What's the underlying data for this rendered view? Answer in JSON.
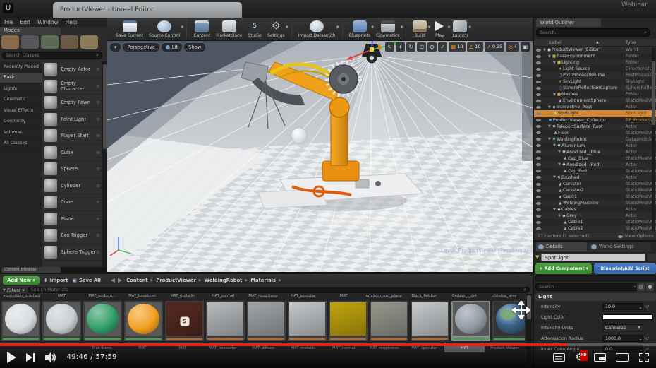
{
  "window": {
    "logo": "U",
    "tab_title": "ProductViewer - Unreal Editor",
    "menu": [
      "File",
      "Edit",
      "Window",
      "Help"
    ],
    "watermark": "Webinar"
  },
  "toolbar": {
    "buttons": [
      {
        "label": "Save Current",
        "icon": "save"
      },
      {
        "label": "Source Control",
        "icon": "sourcecontrol",
        "dropdown": true,
        "sep": true
      },
      {
        "label": "Content",
        "icon": "content"
      },
      {
        "label": "Marketplace",
        "icon": "marketplace"
      },
      {
        "label": "Studio",
        "icon": "studio",
        "glyph": "S"
      },
      {
        "label": "Settings",
        "icon": "settings",
        "glyph": "⚙",
        "dropdown": true,
        "sep": true
      },
      {
        "label": "Import Datasmith",
        "icon": "import",
        "dropdown": true,
        "sep": true
      },
      {
        "label": "Blueprints",
        "icon": "blueprints",
        "dropdown": true
      },
      {
        "label": "Cinematics",
        "icon": "cinematics",
        "dropdown": true,
        "sep": true
      },
      {
        "label": "Build",
        "icon": "build",
        "dropdown": true
      },
      {
        "label": "Play",
        "icon": "play",
        "dropdown": true
      },
      {
        "label": "Launch",
        "icon": "launch",
        "dropdown": true
      }
    ]
  },
  "modes": {
    "title": "Modes",
    "search_placeholder": "Search Classes",
    "categories": [
      {
        "label": "Recently Placed"
      },
      {
        "label": "Basic",
        "active": true
      },
      {
        "label": "Lights"
      },
      {
        "label": "Cinematic"
      },
      {
        "label": "Visual Effects"
      },
      {
        "label": "Geometry"
      },
      {
        "label": "Volumes"
      },
      {
        "label": "All Classes"
      }
    ],
    "items": [
      {
        "label": "Empty Actor"
      },
      {
        "label": "Empty Character"
      },
      {
        "label": "Empty Pawn"
      },
      {
        "label": "Point Light"
      },
      {
        "label": "Player Start"
      },
      {
        "label": "Cube"
      },
      {
        "label": "Sphere"
      },
      {
        "label": "Cylinder"
      },
      {
        "label": "Cone"
      },
      {
        "label": "Plane"
      },
      {
        "label": "Box Trigger"
      },
      {
        "label": "Sphere Trigger"
      }
    ]
  },
  "viewport": {
    "camera": "Perspective",
    "view_mode": "Lit",
    "show_menu": "Show",
    "snaps": [
      {
        "icon": "▦",
        "value": "10"
      },
      {
        "icon": "∠",
        "value": "10"
      },
      {
        "icon": "↗",
        "value": "0.25"
      },
      {
        "icon": "◎",
        "value": "4"
      }
    ],
    "level_label": "Level: ProductViewer (Persistent)"
  },
  "outliner": {
    "tab": "World Outliner",
    "search_placeholder": "Search...",
    "col_label": "Label",
    "sort": "▲",
    "col_type": "Type",
    "rows": [
      {
        "indent": 0,
        "label": "ProductViewer (Editor)",
        "type": "World",
        "icon": "world",
        "glyph": "●",
        "exp": true
      },
      {
        "indent": 1,
        "label": "BaseEnvironment",
        "type": "Folder",
        "icon": "folder",
        "glyph": "■",
        "exp": true
      },
      {
        "indent": 2,
        "label": "Lighting",
        "type": "Folder",
        "icon": "folder",
        "glyph": "■",
        "exp": true
      },
      {
        "indent": 3,
        "label": "Light Source",
        "type": "DirectionalLight",
        "icon": "light",
        "glyph": "☀"
      },
      {
        "indent": 3,
        "label": "PostProcessVolume",
        "type": "PostProcessVolume",
        "icon": "ppv",
        "glyph": "□"
      },
      {
        "indent": 3,
        "label": "SkyLight",
        "type": "SkyLight",
        "icon": "sky",
        "glyph": "☀"
      },
      {
        "indent": 3,
        "label": "SphereReflectionCapture",
        "type": "SphereReflectionCa",
        "icon": "capture",
        "glyph": "○"
      },
      {
        "indent": 2,
        "label": "Meshes",
        "type": "Folder",
        "icon": "folder",
        "glyph": "■",
        "exp": true
      },
      {
        "indent": 3,
        "label": "EnvironmentSphere",
        "type": "StaticMeshActor",
        "icon": "mesh",
        "glyph": "▲"
      },
      {
        "indent": 1,
        "label": "Interactive_Root",
        "type": "Actor",
        "icon": "actor",
        "glyph": "◆",
        "exp": true
      },
      {
        "indent": 2,
        "label": "SpotLight",
        "type": "SpotLight",
        "icon": "spot",
        "glyph": "▼",
        "selected": true
      },
      {
        "indent": 1,
        "label": "ProductViewer_Collector",
        "type": "BP_ProductViewer_C",
        "icon": "bp",
        "glyph": "◆",
        "orange": true
      },
      {
        "indent": 1,
        "label": "TeleportSurface_Root",
        "type": "Actor",
        "icon": "actor",
        "glyph": "◆",
        "exp": true
      },
      {
        "indent": 2,
        "label": "Floor",
        "type": "StaticMeshActor",
        "icon": "mesh",
        "glyph": "▲"
      },
      {
        "indent": 1,
        "label": "WeldingRobot",
        "type": "DatasmithSceneActor",
        "icon": "datasmith",
        "glyph": "◆",
        "exp": true
      },
      {
        "indent": 2,
        "label": "Aluminium",
        "type": "Actor",
        "icon": "actor",
        "glyph": "◆",
        "exp": true
      },
      {
        "indent": 3,
        "label": "Anodized__Blue",
        "type": "Actor",
        "icon": "actor",
        "glyph": "◆",
        "exp": true
      },
      {
        "indent": 4,
        "label": "Cap_Blue",
        "type": "StaticMeshActor",
        "icon": "mesh",
        "glyph": "▲"
      },
      {
        "indent": 3,
        "label": "Anodized__Red",
        "type": "Actor",
        "icon": "actor",
        "glyph": "◆",
        "exp": true
      },
      {
        "indent": 4,
        "label": "Cap_Red",
        "type": "StaticMeshActor",
        "icon": "mesh",
        "glyph": "▲"
      },
      {
        "indent": 2,
        "label": "Brushed",
        "type": "Actor",
        "icon": "actor",
        "glyph": "◆",
        "exp": true
      },
      {
        "indent": 3,
        "label": "Canister",
        "type": "StaticMeshActor",
        "icon": "mesh",
        "glyph": "▲"
      },
      {
        "indent": 3,
        "label": "Canister2",
        "type": "StaticMeshActor",
        "icon": "mesh",
        "glyph": "▲"
      },
      {
        "indent": 3,
        "label": "Cap01",
        "type": "StaticMeshActor",
        "icon": "mesh",
        "glyph": "▲"
      },
      {
        "indent": 3,
        "label": "WeldingMachine",
        "type": "StaticMeshActor",
        "icon": "mesh",
        "glyph": "▲"
      },
      {
        "indent": 2,
        "label": "Cables",
        "type": "Actor",
        "icon": "actor",
        "glyph": "◆",
        "exp": true
      },
      {
        "indent": 3,
        "label": "Grey",
        "type": "Actor",
        "icon": "actor",
        "glyph": "◆",
        "exp": true
      },
      {
        "indent": 4,
        "label": "Cable1",
        "type": "StaticMeshActor",
        "icon": "mesh",
        "glyph": "▲"
      },
      {
        "indent": 4,
        "label": "Cable2",
        "type": "StaticMeshActor",
        "icon": "mesh",
        "glyph": "▲"
      }
    ],
    "status": "133 actors (1 selected)",
    "view_options": "View Options"
  },
  "details": {
    "tab_details": "Details",
    "tab_world": "World Settings",
    "name_value": "SpotLight",
    "add_component": "+ Add Component ▾",
    "blueprint_button": "Blueprint/Add Script",
    "search_placeholder": "Search",
    "section": "Light",
    "properties": [
      {
        "label": "Intensity",
        "value": "10.0",
        "spin": true
      },
      {
        "label": "Light Color",
        "color": "#ffffff",
        "is_color": true
      },
      {
        "label": "Intensity Units",
        "value": "Candelas",
        "dropdown": true
      },
      {
        "label": "Attenuation Radius",
        "value": "1000.0",
        "spin": true
      },
      {
        "label": "Inner Cone Angle",
        "value": "0.0",
        "spin": true
      }
    ]
  },
  "content_browser": {
    "panel_tab": "Content Browser",
    "add_new": "Add New ▾",
    "import": "Import",
    "save_all": "Save All",
    "breadcrumbs": [
      "Content",
      "ProductViewer",
      "WeldingRobot",
      "Materials"
    ],
    "filters": "Filters ▾",
    "search_placeholder": "Search Materials",
    "tiles": [
      {
        "above": "aluminium_brushed",
        "below": "",
        "shape": "sphere",
        "color": "#d8dce0",
        "bar": "#3aa745"
      },
      {
        "above": "MAT",
        "below": "",
        "shape": "sphere",
        "color": "#c9ced2",
        "bar": "#3aa745"
      },
      {
        "above": "MAT_ambien...",
        "below": "Mat_Stone",
        "shape": "sphere",
        "color": "#2e9e66",
        "bar": "#3aa745"
      },
      {
        "above": "MAT_basecolor",
        "below": "MAT",
        "shape": "sphere",
        "color": "#f2a018",
        "bar": "#3aa745"
      },
      {
        "above": "MAT_metallic",
        "below": "MAT",
        "shape": "flat",
        "color": "#572a22",
        "bar": "#c8641e",
        "badge": "S"
      },
      {
        "above": "MAT_normal",
        "below": "MAT_basecolor",
        "shape": "flat",
        "color": "#b7bbbe",
        "bar": "#c8641e"
      },
      {
        "above": "MAT_roughness",
        "below": "MAT_diffuse",
        "shape": "flat",
        "color": "#a0a6a9",
        "bar": "#c8641e"
      },
      {
        "above": "MAT_specular",
        "below": "MAT_metallic",
        "shape": "flat",
        "color": "#c4c8ca",
        "bar": "#c8641e"
      },
      {
        "above": "MAT",
        "below": "MAT_normal",
        "shape": "flat",
        "color": "#c2a50e",
        "bar": "#c8641e"
      },
      {
        "above": "environment_plane",
        "below": "MAT_roughness",
        "shape": "flat",
        "color": "#97998f",
        "bar": "#c8641e"
      },
      {
        "above": "Black_Rubber",
        "below": "MAT_specular",
        "shape": "flat",
        "color": "#c6cacc",
        "bar": "#c8641e"
      },
      {
        "above": "Carbon_r_dot",
        "below": "MAT",
        "shape": "sphere",
        "color": "#9099a2",
        "bar": "#3aa745",
        "selected": true
      },
      {
        "above": "chrome_grey",
        "below": "Product_Viewer",
        "shape": "globe",
        "color": "#2c4258",
        "bar": "#3aa745"
      }
    ]
  },
  "player": {
    "time": "49:46 / 57:59",
    "progress_pct": 86.4,
    "hd_badge": "HD",
    "accent_red": "#e62117"
  }
}
